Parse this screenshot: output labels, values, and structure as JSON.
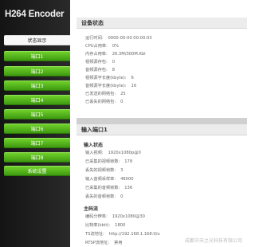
{
  "app": {
    "title": "H264 Encoder"
  },
  "sidebar": {
    "items": [
      {
        "label": "状态显示",
        "active": true
      },
      {
        "label": "端口1"
      },
      {
        "label": "端口2"
      },
      {
        "label": "端口3"
      },
      {
        "label": "端口4"
      },
      {
        "label": "端口5"
      },
      {
        "label": "端口6"
      },
      {
        "label": "端口7"
      },
      {
        "label": "端口8"
      },
      {
        "label": "系统设置"
      }
    ]
  },
  "device_status": {
    "title": "设备状态",
    "rows": [
      {
        "label": "运行时间:",
        "value": "0000-00-00 00:00:03"
      },
      {
        "label": "CPU占用率:",
        "value": "0%"
      },
      {
        "label": "内存占用率:",
        "value": "26.3M/300M.Kbl"
      },
      {
        "label": "视频源存包:",
        "value": "0"
      },
      {
        "label": "音频源存包:",
        "value": "8"
      },
      {
        "label": "视频源字长度(kbyte):",
        "value": "6"
      },
      {
        "label": "音频源字长度(kbyte):",
        "value": "16"
      },
      {
        "label": "已发送的网络包:",
        "value": "25"
      },
      {
        "label": "已丢失的网络包:",
        "value": "0"
      }
    ]
  },
  "input_port": {
    "title": "输入端口1",
    "input_status": {
      "title": "输入状态",
      "rows": [
        {
          "label": "输入视频:",
          "value": "1920x1080p@0"
        },
        {
          "label": "已采集的视频帧数:",
          "value": "178"
        },
        {
          "label": "丢失的视频帧数:",
          "value": "3"
        },
        {
          "label": "输入音频采样率:",
          "value": "48000"
        },
        {
          "label": "已采集的音频帧数:",
          "value": "136"
        },
        {
          "label": "丢失的音频帧数:",
          "value": "0"
        }
      ]
    },
    "main_stream": {
      "title": "主码流",
      "rows": [
        {
          "label": "编码分辨率:",
          "value": "1920x1080@30"
        },
        {
          "label": "比特率(kbit):",
          "value": "1800"
        },
        {
          "label": "TS流地址:",
          "value": "http://192.168.1.168:0/u"
        },
        {
          "label": "RTSP流地址:",
          "value": "禁用"
        }
      ]
    }
  },
  "watermark": "成都中天之光科技有限公司"
}
